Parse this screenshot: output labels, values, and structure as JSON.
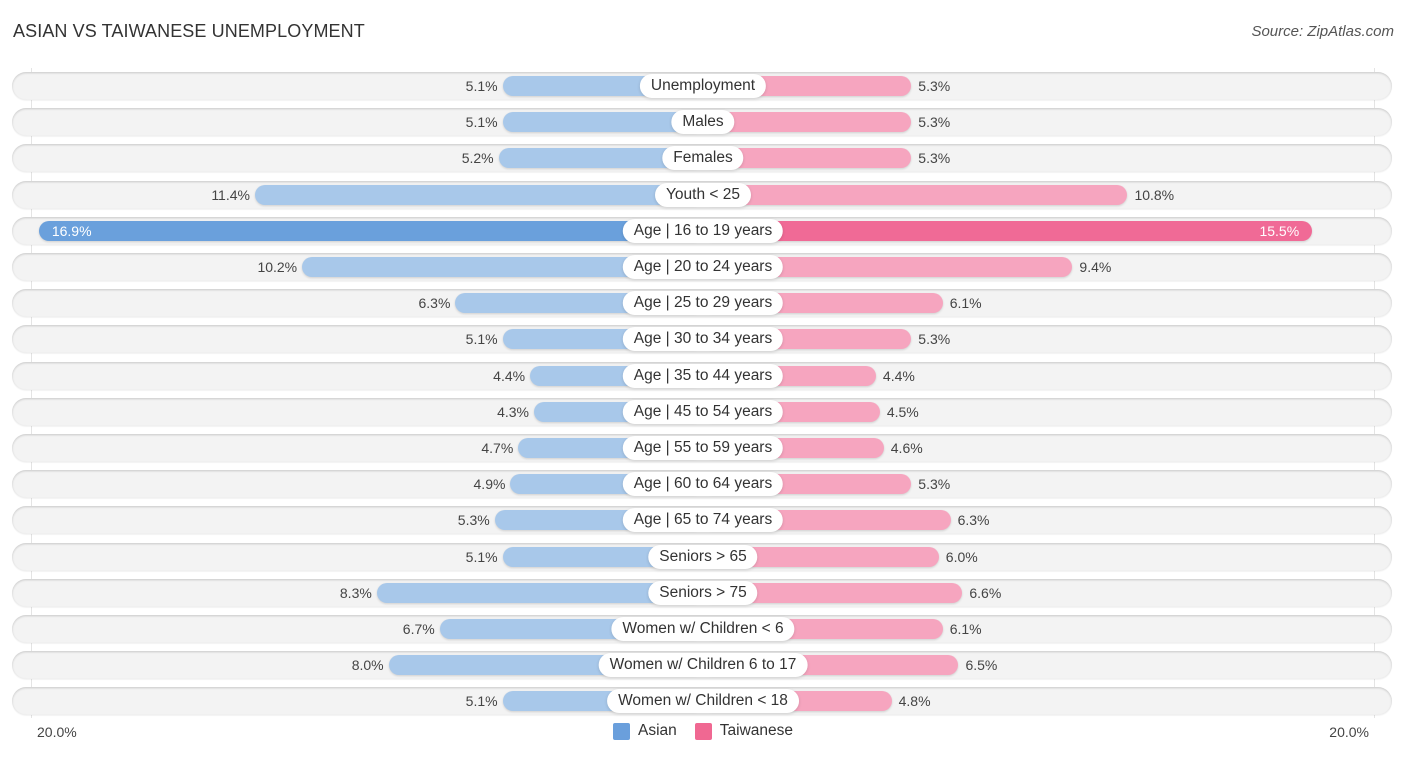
{
  "header": {
    "title": "ASIAN VS TAIWANESE UNEMPLOYMENT",
    "source": "Source: ZipAtlas.com"
  },
  "colors": {
    "asian": "#a8c8ea",
    "asian_highlight": "#6aa0dc",
    "taiwanese": "#f6a5bf",
    "taiwanese_highlight": "#f06a96",
    "legend_asian": "#6a9fdc",
    "legend_taiwanese": "#f06892"
  },
  "chart_data": {
    "type": "bar",
    "orientation": "horizontal-diverging",
    "title": "ASIAN VS TAIWANESE UNEMPLOYMENT",
    "source": "Source: ZipAtlas.com",
    "categories": [
      "Unemployment",
      "Males",
      "Females",
      "Youth < 25",
      "Age | 16 to 19 years",
      "Age | 20 to 24 years",
      "Age | 25 to 29 years",
      "Age | 30 to 34 years",
      "Age | 35 to 44 years",
      "Age | 45 to 54 years",
      "Age | 55 to 59 years",
      "Age | 60 to 64 years",
      "Age | 65 to 74 years",
      "Seniors > 65",
      "Seniors > 75",
      "Women w/ Children < 6",
      "Women w/ Children 6 to 17",
      "Women w/ Children < 18"
    ],
    "series": [
      {
        "name": "Asian",
        "side": "left",
        "values": [
          5.1,
          5.1,
          5.2,
          11.4,
          16.9,
          10.2,
          6.3,
          5.1,
          4.4,
          4.3,
          4.7,
          4.9,
          5.3,
          5.1,
          8.3,
          6.7,
          8.0,
          5.1
        ],
        "labels": [
          "5.1%",
          "5.1%",
          "5.2%",
          "11.4%",
          "16.9%",
          "10.2%",
          "6.3%",
          "5.1%",
          "4.4%",
          "4.3%",
          "4.7%",
          "4.9%",
          "5.3%",
          "5.1%",
          "8.3%",
          "6.7%",
          "8.0%",
          "5.1%"
        ]
      },
      {
        "name": "Taiwanese",
        "side": "right",
        "values": [
          5.3,
          5.3,
          5.3,
          10.8,
          15.5,
          9.4,
          6.1,
          5.3,
          4.4,
          4.5,
          4.6,
          5.3,
          6.3,
          6.0,
          6.6,
          6.1,
          6.5,
          4.8
        ],
        "labels": [
          "5.3%",
          "5.3%",
          "5.3%",
          "10.8%",
          "15.5%",
          "9.4%",
          "6.1%",
          "5.3%",
          "4.4%",
          "4.5%",
          "4.6%",
          "5.3%",
          "6.3%",
          "6.0%",
          "6.6%",
          "6.1%",
          "6.5%",
          "4.8%"
        ]
      }
    ],
    "highlight_index": 4,
    "xlim": [
      -20,
      20
    ],
    "axis_labels": {
      "left": "20.0%",
      "right": "20.0%"
    },
    "unit": "%",
    "legend": {
      "position": "bottom-center",
      "entries": [
        "Asian",
        "Taiwanese"
      ]
    },
    "grid": false
  }
}
